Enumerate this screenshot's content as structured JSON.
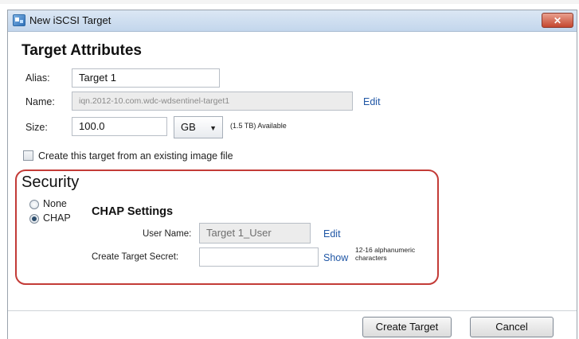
{
  "window": {
    "title": "New iSCSI Target",
    "close_label": "✕"
  },
  "attributes": {
    "heading": "Target Attributes",
    "alias_label": "Alias:",
    "alias_value": "Target 1",
    "name_label": "Name:",
    "name_value": "iqn.2012-10.com.wdc-wdsentinel-target1",
    "name_edit": "Edit",
    "size_label": "Size:",
    "size_value": "100.0",
    "size_unit": "GB",
    "size_unit_arrow": "▼",
    "available": "(1.5 TB) Available",
    "from_image_label": "Create this target from an existing image file"
  },
  "security": {
    "title": "Security",
    "options": [
      {
        "label": "None",
        "selected": false
      },
      {
        "label": "CHAP",
        "selected": true
      }
    ],
    "chap": {
      "title": "CHAP Settings",
      "username_label": "User Name:",
      "username_value": "Target 1_User",
      "username_edit": "Edit",
      "secret_label": "Create Target Secret:",
      "secret_value": "",
      "secret_show": "Show",
      "secret_hint": "12-16 alphanumeric characters"
    }
  },
  "footer": {
    "create_label": "Create Target",
    "cancel_label": "Cancel"
  },
  "colors": {
    "security_border": "#c33b37",
    "link": "#1f56a5",
    "titlebar": "#c3d6ec",
    "close_button": "#c4472f"
  }
}
